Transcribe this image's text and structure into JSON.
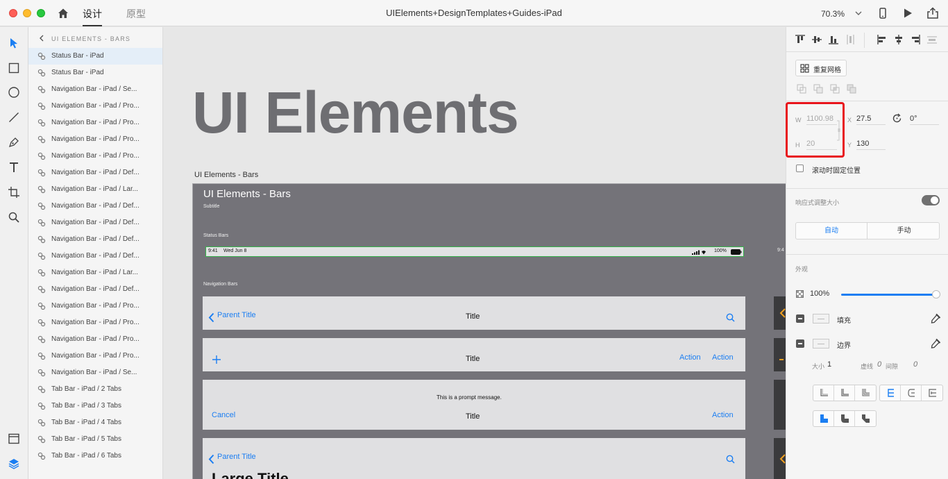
{
  "titlebar": {
    "tab_design": "设计",
    "tab_prototype": "原型",
    "document_title": "UIElements+DesignTemplates+Guides-iPad",
    "zoom": "70.3%"
  },
  "layers": {
    "header": "UI ELEMENTS - BARS",
    "items": [
      "Status Bar - iPad",
      "Status Bar - iPad",
      "Navigation Bar - iPad / Se...",
      "Navigation Bar - iPad / Pro...",
      "Navigation Bar - iPad / Pro...",
      "Navigation Bar - iPad / Pro...",
      "Navigation Bar - iPad / Pro...",
      "Navigation Bar - iPad / Def...",
      "Navigation Bar - iPad / Lar...",
      "Navigation Bar - iPad / Def...",
      "Navigation Bar - iPad / Def...",
      "Navigation Bar - iPad / Def...",
      "Navigation Bar - iPad / Def...",
      "Navigation Bar - iPad / Lar...",
      "Navigation Bar - iPad / Def...",
      "Navigation Bar - iPad / Pro...",
      "Navigation Bar - iPad / Pro...",
      "Navigation Bar - iPad / Pro...",
      "Navigation Bar - iPad / Pro...",
      "Navigation Bar - iPad / Se...",
      "Tab Bar - iPad / 2 Tabs",
      "Tab Bar - iPad / 3 Tabs",
      "Tab Bar - iPad / 4 Tabs",
      "Tab Bar - iPad / 5 Tabs",
      "Tab Bar - iPad / 6 Tabs"
    ]
  },
  "canvas": {
    "big_title": "UI Elements",
    "artboard_label": "UI Elements - Bars",
    "artboard": {
      "title": "UI Elements - Bars",
      "subtitle": "Subtitle",
      "status_section": "Status Bars",
      "nav_section": "Navigation Bars",
      "status_time": "9:41",
      "status_date": "Wed Jun 8",
      "status_battery": "100%",
      "side_time": "9:4",
      "nav1": {
        "back": "Parent Title",
        "title": "Title"
      },
      "nav2": {
        "title": "Title",
        "action1": "Action",
        "action2": "Action"
      },
      "nav3": {
        "prompt": "This is a prompt message.",
        "cancel": "Cancel",
        "title": "Title",
        "action": "Action"
      },
      "nav4": {
        "back": "Parent Title",
        "large_title": "Large Title"
      }
    }
  },
  "inspector": {
    "repeat_grid": "重复网格",
    "w_label": "W",
    "w_value": "1100.98",
    "h_label": "H",
    "h_value": "20",
    "x_label": "X",
    "x_value": "27.5",
    "y_label": "Y",
    "y_value": "130",
    "rotation": "0°",
    "fixed_position": "滚动时固定位置",
    "responsive_resize": "响应式调整大小",
    "auto": "自动",
    "manual": "手动",
    "appearance": "外观",
    "opacity": "100%",
    "opacity_fraction": 1.0,
    "fill": "填充",
    "border": "边界",
    "size_label": "大小",
    "size_value": "1",
    "dash_label": "虚线",
    "dash_value": "0",
    "gap_label": "间隙",
    "gap_value": "0"
  },
  "colors": {
    "accent": "#1b7ef2",
    "highlight": "#e8141b",
    "selection_border": "#35b24a"
  }
}
